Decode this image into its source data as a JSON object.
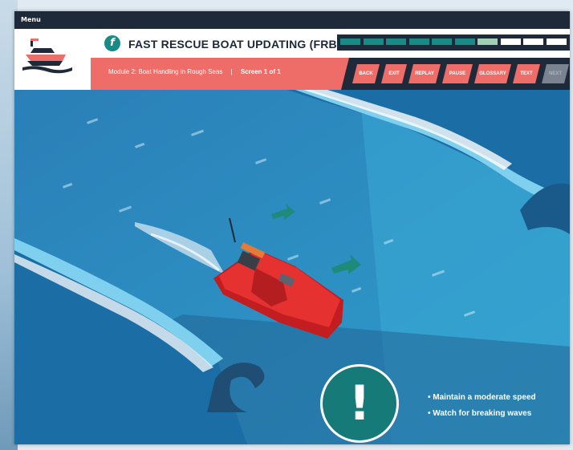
{
  "menu": {
    "label": "Menu"
  },
  "header": {
    "course_title": "FAST RESCUE BOAT UPDATING (FRBU)",
    "course_icon": "f-badge-icon",
    "module_label": "Module 2: Boat Handling in Rough Seas",
    "separator": "|",
    "screen_label": "Screen 1 of 1",
    "progress_segments": [
      "complete",
      "complete",
      "complete",
      "complete",
      "complete",
      "complete",
      "current",
      "incomplete",
      "incomplete",
      "incomplete"
    ]
  },
  "nav": {
    "buttons": [
      {
        "label": "BACK",
        "enabled": true
      },
      {
        "label": "EXIT",
        "enabled": true
      },
      {
        "label": "REPLAY",
        "enabled": true
      },
      {
        "label": "PAUSE",
        "enabled": true
      },
      {
        "label": "GLOSSARY",
        "enabled": true
      },
      {
        "label": "TEXT",
        "enabled": true
      },
      {
        "label": "NEXT",
        "enabled": false
      }
    ]
  },
  "content": {
    "alert_icon": "exclamation-icon",
    "alert_symbol": "!",
    "tips": [
      "• Maintain a moderate speed",
      "• Watch for breaking waves"
    ]
  },
  "colors": {
    "accent": "#ef6d68",
    "dark": "#1e2a39",
    "teal": "#1a8a86",
    "progress_complete": "#1a8a86",
    "progress_current": "#9fd1b2",
    "progress_incomplete": "#ffffff",
    "sea": "#2c93c4"
  }
}
